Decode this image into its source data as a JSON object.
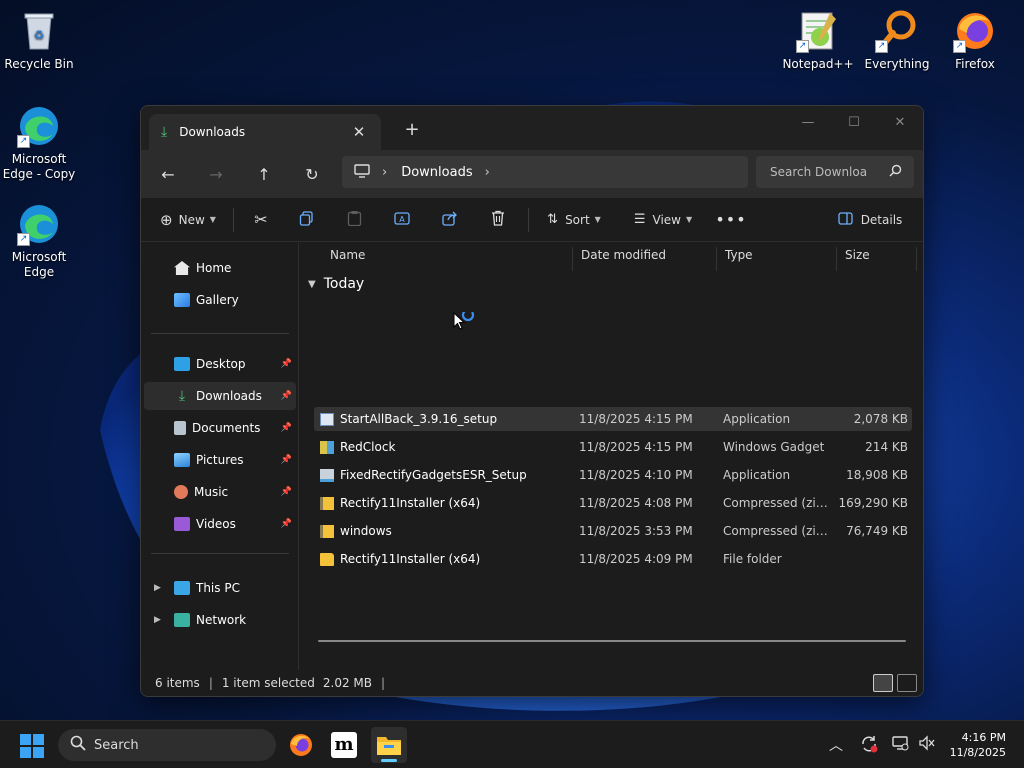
{
  "desktop": {
    "icons": [
      {
        "label": "Recycle Bin",
        "icon": "recycle-bin-icon"
      },
      {
        "label": "Microsoft Edge - Copy",
        "icon": "edge-icon"
      },
      {
        "label": "Microsoft Edge",
        "icon": "edge-icon"
      },
      {
        "label": "Notepad++",
        "icon": "notepadpp-icon"
      },
      {
        "label": "Everything",
        "icon": "everything-icon"
      },
      {
        "label": "Firefox",
        "icon": "firefox-icon"
      }
    ]
  },
  "window": {
    "tab_title": "Downloads",
    "address": {
      "crumb": "Downloads"
    },
    "search": {
      "placeholder": "Search Downloa"
    },
    "toolbar": {
      "new_label": "New",
      "sort_label": "Sort",
      "view_label": "View",
      "details_label": "Details"
    },
    "sidebar": {
      "items": [
        {
          "label": "Home"
        },
        {
          "label": "Gallery"
        },
        {
          "label": "Desktop"
        },
        {
          "label": "Downloads"
        },
        {
          "label": "Documents"
        },
        {
          "label": "Pictures"
        },
        {
          "label": "Music"
        },
        {
          "label": "Videos"
        },
        {
          "label": "This PC"
        },
        {
          "label": "Network"
        }
      ]
    },
    "columns": {
      "name": "Name",
      "date": "Date modified",
      "type": "Type",
      "size": "Size"
    },
    "group": "Today",
    "files": [
      {
        "name": "StartAllBack_3.9.16_setup",
        "date": "11/8/2025 4:15 PM",
        "type": "Application",
        "size": "2,078 KB"
      },
      {
        "name": "RedClock",
        "date": "11/8/2025 4:15 PM",
        "type": "Windows Gadget",
        "size": "214 KB"
      },
      {
        "name": "FixedRectifyGadgetsESR_Setup",
        "date": "11/8/2025 4:10 PM",
        "type": "Application",
        "size": "18,908 KB"
      },
      {
        "name": "Rectify11Installer (x64)",
        "date": "11/8/2025 4:08 PM",
        "type": "Compressed (zipp...",
        "size": "169,290 KB"
      },
      {
        "name": "windows",
        "date": "11/8/2025 3:53 PM",
        "type": "Compressed (zipp...",
        "size": "76,749 KB"
      },
      {
        "name": "Rectify11Installer (x64)",
        "date": "11/8/2025 4:09 PM",
        "type": "File folder",
        "size": ""
      }
    ],
    "status": {
      "count": "6 items",
      "selected": "1 item selected",
      "size": "2.02 MB"
    }
  },
  "taskbar": {
    "search_label": "Search",
    "time": "4:16 PM",
    "date": "11/8/2025"
  },
  "colors": {
    "accent": "#60cdff",
    "folder": "#f3c13a",
    "selection": "#343434"
  }
}
